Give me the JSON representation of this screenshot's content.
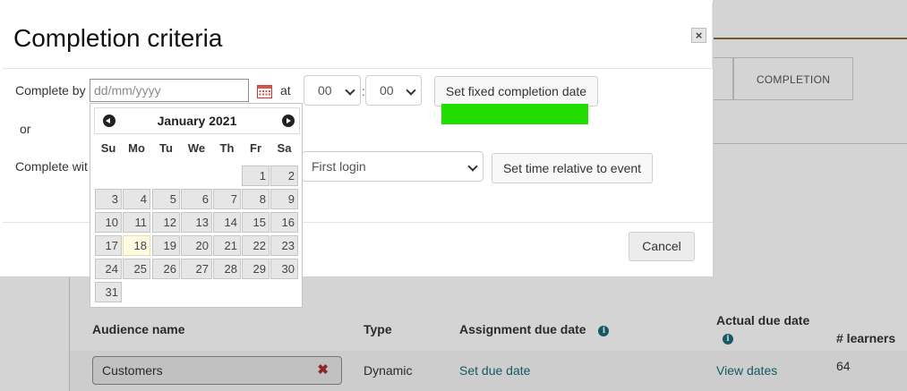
{
  "background": {
    "tab_label": "COMPLETION",
    "table": {
      "headers": {
        "audience_name": "Audience name",
        "type": "Type",
        "assignment_due_date": "Assignment due date",
        "actual_due_date": "Actual due date",
        "learners": "# learners"
      },
      "row": {
        "audience": "Customers",
        "type": "Dynamic",
        "assignment_due_date": "Set due date",
        "actual_due_date": "View dates",
        "learners": "64"
      }
    }
  },
  "modal": {
    "title": "Completion criteria",
    "close_glyph": "×",
    "complete_by_label": "Complete by",
    "date_placeholder": "dd/mm/yyyy",
    "at_label": "at",
    "hour_value": "00",
    "colon": ":",
    "minute_value": "00",
    "set_fixed_button": "Set fixed completion date",
    "or_label": "or",
    "complete_within_label": "Complete wit",
    "event_select_value": "First login",
    "set_relative_button": "Set time relative to event",
    "cancel_button": "Cancel"
  },
  "datepicker": {
    "month_year": "January 2021",
    "weekdays": [
      "Su",
      "Mo",
      "Tu",
      "We",
      "Th",
      "Fr",
      "Sa"
    ],
    "days": [
      "1",
      "2",
      "3",
      "4",
      "5",
      "6",
      "7",
      "8",
      "9",
      "10",
      "11",
      "12",
      "13",
      "14",
      "15",
      "16",
      "17",
      "18",
      "19",
      "20",
      "21",
      "22",
      "23",
      "24",
      "25",
      "26",
      "27",
      "28",
      "29",
      "30",
      "31"
    ],
    "first_weekday_index": 5,
    "highlighted_day": "18"
  },
  "colors": {
    "accent_link": "#1a6b7a",
    "highlight_mark": "#22dd00",
    "today_cell": "#fffbe0",
    "remove_x": "#a83232"
  }
}
